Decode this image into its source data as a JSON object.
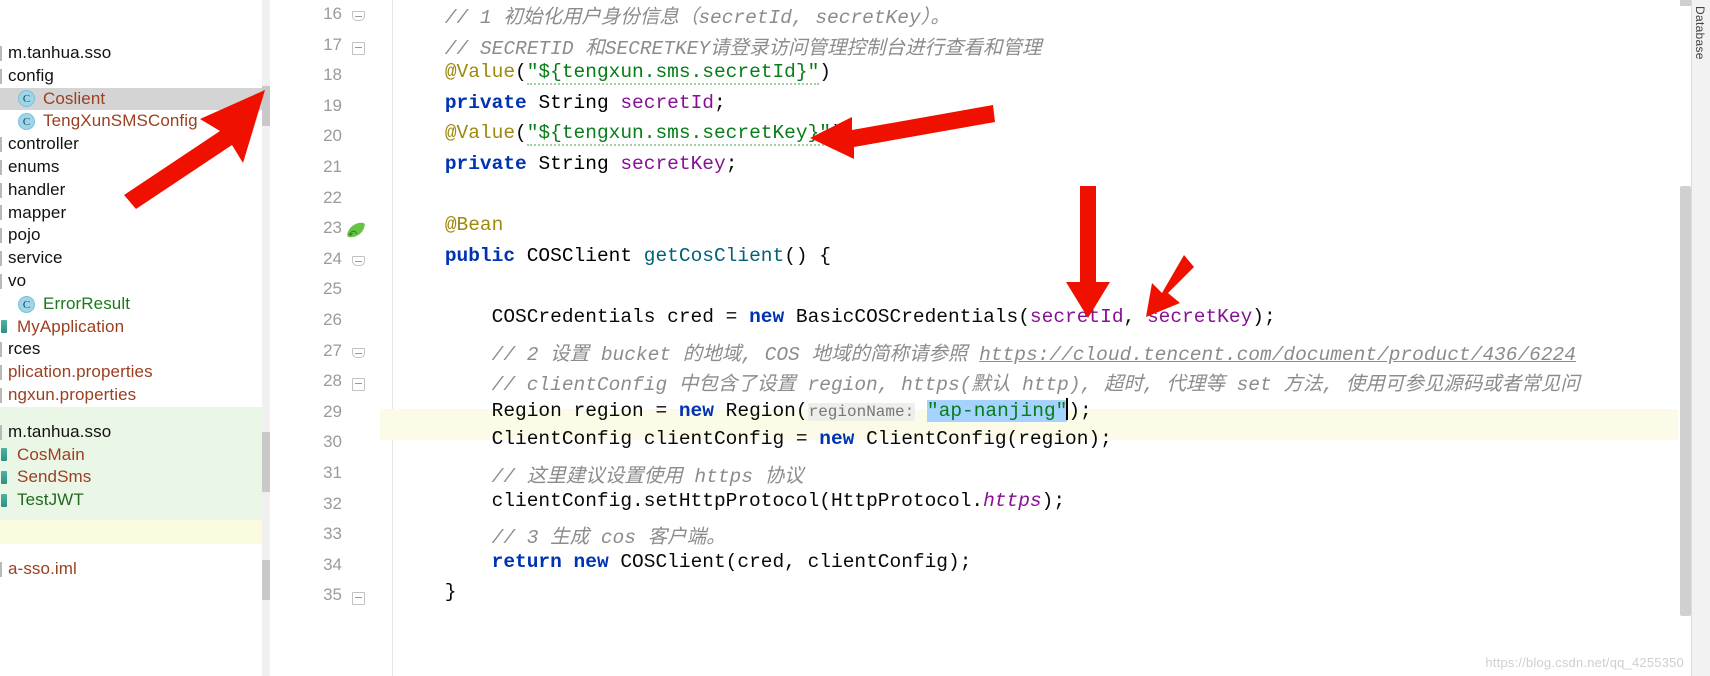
{
  "sidebar": {
    "items": [
      {
        "label": "m.tanhua.sso",
        "kind": "package",
        "indent": 0,
        "color": "black",
        "selected": false
      },
      {
        "label": "config",
        "kind": "folder",
        "indent": 0,
        "color": "black",
        "selected": false
      },
      {
        "label": "Coslient",
        "kind": "class",
        "indent": 1,
        "color": "brown",
        "selected": true
      },
      {
        "label": "TengXunSMSConfig",
        "kind": "class",
        "indent": 1,
        "color": "brown",
        "selected": false
      },
      {
        "label": "controller",
        "kind": "folder",
        "indent": 0,
        "color": "black",
        "selected": false
      },
      {
        "label": "enums",
        "kind": "folder",
        "indent": 0,
        "color": "black",
        "selected": false
      },
      {
        "label": "handler",
        "kind": "folder",
        "indent": 0,
        "color": "black",
        "selected": false
      },
      {
        "label": "mapper",
        "kind": "folder",
        "indent": 0,
        "color": "black",
        "selected": false
      },
      {
        "label": "pojo",
        "kind": "folder",
        "indent": 0,
        "color": "black",
        "selected": false
      },
      {
        "label": "service",
        "kind": "folder",
        "indent": 0,
        "color": "black",
        "selected": false
      },
      {
        "label": "vo",
        "kind": "folder",
        "indent": 0,
        "color": "black",
        "selected": false
      },
      {
        "label": "ErrorResult",
        "kind": "class",
        "indent": 1,
        "color": "green",
        "selected": false
      },
      {
        "label": "MyApplication",
        "kind": "java",
        "indent": 0,
        "color": "brown",
        "selected": false
      },
      {
        "label": "rces",
        "kind": "folder",
        "indent": 0,
        "color": "black",
        "selected": false
      },
      {
        "label": "plication.properties",
        "kind": "file",
        "indent": 0,
        "color": "brown",
        "selected": false
      },
      {
        "label": "ngxun.properties",
        "kind": "file",
        "indent": 0,
        "color": "brown",
        "selected": false
      }
    ],
    "test_group": [
      {
        "label": "m.tanhua.sso",
        "kind": "package",
        "indent": 0,
        "color": "black"
      },
      {
        "label": "CosMain",
        "kind": "java",
        "indent": 0,
        "color": "brown"
      },
      {
        "label": "SendSms",
        "kind": "java",
        "indent": 0,
        "color": "brown"
      },
      {
        "label": "TestJWT",
        "kind": "java",
        "indent": 0,
        "color": "darkgreen"
      }
    ],
    "module_file": {
      "label": "a-sso.iml",
      "kind": "file",
      "color": "brown"
    }
  },
  "toolwindow": {
    "right_tab_label": "Database"
  },
  "editor": {
    "first_line_number": 16,
    "last_line_number": 35,
    "highlighted_line": 29,
    "lines": [
      {
        "n": 16,
        "text": "// 1 初始化用户身份信息（secretId, secretKey）。"
      },
      {
        "n": 17,
        "text": "// SECRETID 和SECRETKEY请登录访问管理控制台进行查看和管理"
      },
      {
        "n": 18,
        "text": "@Value(\"${tengxun.sms.secretId}\")"
      },
      {
        "n": 19,
        "text": "private String secretId;"
      },
      {
        "n": 20,
        "text": "@Value(\"${tengxun.sms.secretKey}\")"
      },
      {
        "n": 21,
        "text": "private String secretKey;"
      },
      {
        "n": 22,
        "text": ""
      },
      {
        "n": 23,
        "text": "@Bean"
      },
      {
        "n": 24,
        "text": "public COSClient getCosClient() {"
      },
      {
        "n": 25,
        "text": ""
      },
      {
        "n": 26,
        "text": "COSCredentials cred = new BasicCOSCredentials(secretId, secretKey);"
      },
      {
        "n": 27,
        "text": "// 2 设置 bucket 的地域, COS 地域的简称请参照 https://cloud.tencent.com/document/product/436/6224"
      },
      {
        "n": 28,
        "text": "// clientConfig 中包含了设置 region, https(默认 http), 超时, 代理等 set 方法, 使用可参见源码或者常见问"
      },
      {
        "n": 29,
        "text": "Region region = new Region( regionName: \"ap-nanjing\");"
      },
      {
        "n": 30,
        "text": "ClientConfig clientConfig = new ClientConfig(region);"
      },
      {
        "n": 31,
        "text": "// 这里建议设置使用 https 协议"
      },
      {
        "n": 32,
        "text": "clientConfig.setHttpProtocol(HttpProtocol.https);"
      },
      {
        "n": 33,
        "text": "// 3 生成 cos 客户端。"
      },
      {
        "n": 34,
        "text": "return new COSClient(cred, clientConfig);"
      },
      {
        "n": 35,
        "text": "}"
      }
    ],
    "tokens": {
      "c16_comment": "// 1 初始化用户身份信息（secretId, secretKey）。",
      "c17_comment": "// SECRETID 和SECRETKEY请登录访问管理控制台进行查看和管理",
      "c18_anno": "@Value",
      "c18_open": "(",
      "c18_str": "\"${tengxun.sms.secretId}\"",
      "c18_close": ")",
      "c19_kw": "private",
      "c19_type": "String",
      "c19_field": "secretId",
      "c19_semi": ";",
      "c20_anno": "@Value",
      "c20_str": "\"${tengxun.sms.secretKey}\"",
      "c21_kw": "private",
      "c21_type": "String",
      "c21_field": "secretKey",
      "c23_anno": "@Bean",
      "c24_kw": "public",
      "c24_type": "COSClient",
      "c24_mth": "getCosClient",
      "c24_tail": "() {",
      "c26_a": "COSCredentials cred = ",
      "c26_new": "new",
      "c26_b": " BasicCOSCredentials(",
      "c26_p1": "secretId",
      "c26_comma": ", ",
      "c26_p2": "secretKey",
      "c26_tail": ");",
      "c27_cmt": "// 2 设置 bucket 的地域, COS 地域的简称请参照 ",
      "c27_url": "https://cloud.tencent.com/document/product/436/6224",
      "c28_cmt": "// clientConfig 中包含了设置 region, https(默认 http), 超时, 代理等 set 方法, 使用可参见源码或者常见问",
      "c29_a": "Region region = ",
      "c29_new": "new",
      "c29_b": " Region(",
      "c29_hint": "regionName:",
      "c29_str": "\"ap-nanjing\"",
      "c29_tail": ");",
      "c30_a": "ClientConfig clientConfig = ",
      "c30_new": "new",
      "c30_b": " ClientConfig(region);",
      "c31_cmt": "// 这里建议设置使用 https 协议",
      "c32_a": "clientConfig.setHttpProtocol(HttpProtocol.",
      "c32_field": "https",
      "c32_tail": ");",
      "c33_cmt": "// 3 生成 cos 客户端。",
      "c34_kw": "return",
      "c34_new": "new",
      "c34_b": " COSClient(cred, clientConfig);",
      "c35_brace": "}"
    }
  },
  "annotations": {
    "arrow_color": "#f01000",
    "arrow_count": 4
  },
  "watermark": {
    "text": "https://blog.csdn.net/qq_4255350"
  },
  "colors": {
    "keyword": "#0033b3",
    "string": "#067d17",
    "annotation": "#9e880d",
    "field": "#871094",
    "method": "#00627a",
    "comment": "#8c8c8c",
    "selection": "#a6d2ff",
    "highlight_line": "#fcfbe8",
    "sidebar_selected": "#d4d4d4",
    "test_group_bg": "#eaf6e6",
    "module_group_bg": "#fbfbe0"
  }
}
